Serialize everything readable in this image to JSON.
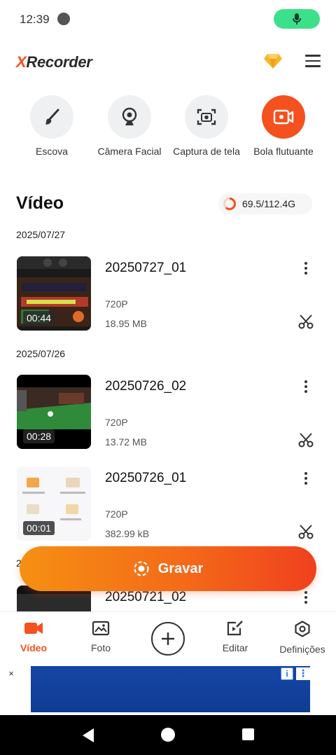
{
  "status_bar": {
    "time": "12:39"
  },
  "header": {
    "logo_prefix": "X",
    "logo_rest": "Recorder"
  },
  "tools": [
    {
      "label": "Escova",
      "icon": "brush-icon"
    },
    {
      "label": "Câmera Facial",
      "icon": "webcam-icon"
    },
    {
      "label": "Captura de tela",
      "icon": "screenshot-icon"
    },
    {
      "label": "Bola flutuante",
      "icon": "floating-ball-icon"
    }
  ],
  "video_section": {
    "title": "Vídeo",
    "storage_text": "69.5/112.4G",
    "storage_used_fraction": 0.618
  },
  "groups": [
    {
      "date": "2025/07/27",
      "videos": [
        {
          "name": "20250727_01",
          "resolution": "720P",
          "size": "18.95 MB",
          "duration": "00:44"
        }
      ]
    },
    {
      "date": "2025/07/26",
      "videos": [
        {
          "name": "20250726_02",
          "resolution": "720P",
          "size": "13.72 MB",
          "duration": "00:28"
        },
        {
          "name": "20250726_01",
          "resolution": "720P",
          "size": "382.99 kB",
          "duration": "00:01"
        }
      ]
    },
    {
      "date": "2",
      "videos": [
        {
          "name": "20250721_02"
        }
      ]
    }
  ],
  "record_button": {
    "label": "Gravar"
  },
  "bottom_nav": [
    {
      "label": "Vídeo",
      "icon": "video-camera-icon",
      "active": true
    },
    {
      "label": "Foto",
      "icon": "photo-icon",
      "active": false
    },
    {
      "label": "Editar",
      "icon": "edit-icon",
      "active": false
    },
    {
      "label": "Definições",
      "icon": "settings-icon",
      "active": false
    }
  ],
  "ad": {
    "close": "×",
    "info": "i",
    "more": "⋮"
  },
  "colors": {
    "accent": "#f4511e",
    "gradient_start": "#f59013",
    "gradient_end": "#f0401f",
    "mic_green": "#3de08a"
  }
}
